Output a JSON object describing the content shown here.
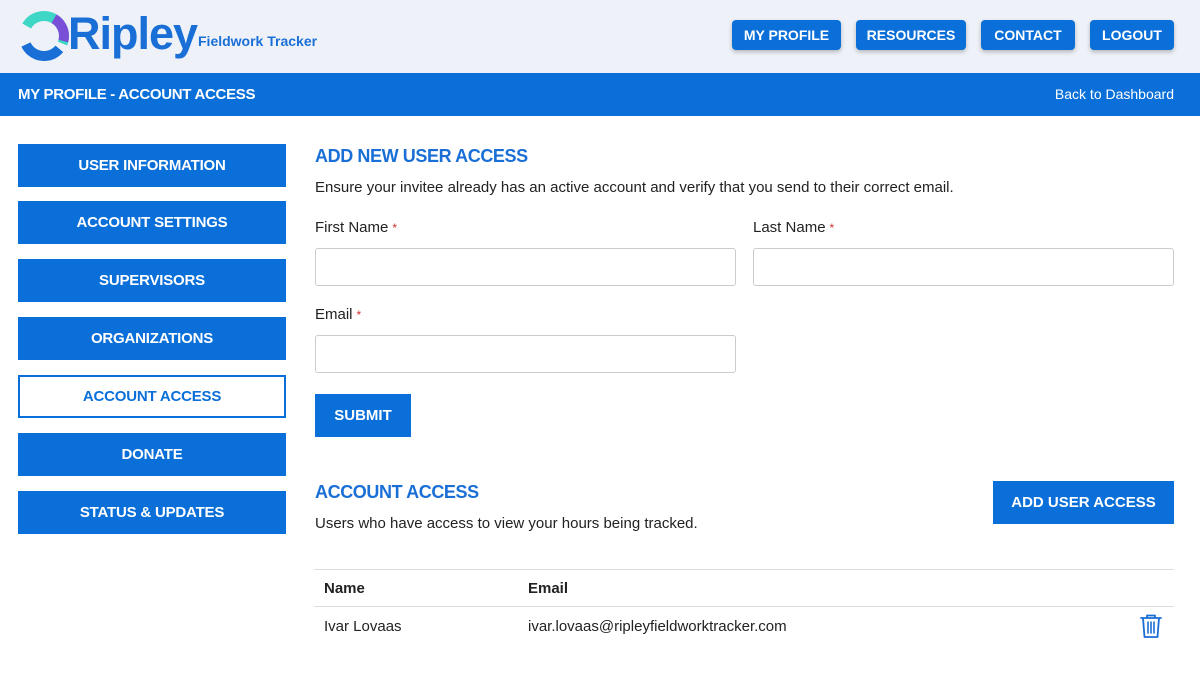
{
  "header": {
    "brand": "Ripley",
    "brand_sub": "Fieldwork Tracker",
    "nav": [
      "MY PROFILE",
      "RESOURCES",
      "CONTACT",
      "LOGOUT"
    ]
  },
  "bar": {
    "title": "MY PROFILE - ACCOUNT ACCESS",
    "back_link": "Back to Dashboard"
  },
  "sidebar": {
    "items": [
      {
        "label": "USER INFORMATION"
      },
      {
        "label": "ACCOUNT SETTINGS"
      },
      {
        "label": "SUPERVISORS"
      },
      {
        "label": "ORGANIZATIONS"
      },
      {
        "label": "ACCOUNT ACCESS",
        "active": true
      },
      {
        "label": "DONATE"
      },
      {
        "label": "STATUS & UPDATES"
      }
    ]
  },
  "form": {
    "title": "ADD NEW USER ACCESS",
    "description": "Ensure your invitee already has an active account and verify that you send to their correct email.",
    "first_name_label": "First Name",
    "last_name_label": "Last Name",
    "email_label": "Email",
    "required_mark": "*",
    "first_name_value": "",
    "last_name_value": "",
    "email_value": "",
    "submit_label": "SUBMIT"
  },
  "access": {
    "title": "ACCOUNT ACCESS",
    "description": "Users who have access to view your hours being tracked.",
    "add_button": "ADD USER ACCESS",
    "columns": [
      "Name",
      "Email"
    ],
    "rows": [
      {
        "name": "Ivar Lovaas",
        "email": "ivar.lovaas@ripleyfieldworktracker.com"
      }
    ]
  },
  "colors": {
    "primary": "#0a6fd8",
    "header_bg": "#eef2f8",
    "required": "#d32f2f"
  }
}
